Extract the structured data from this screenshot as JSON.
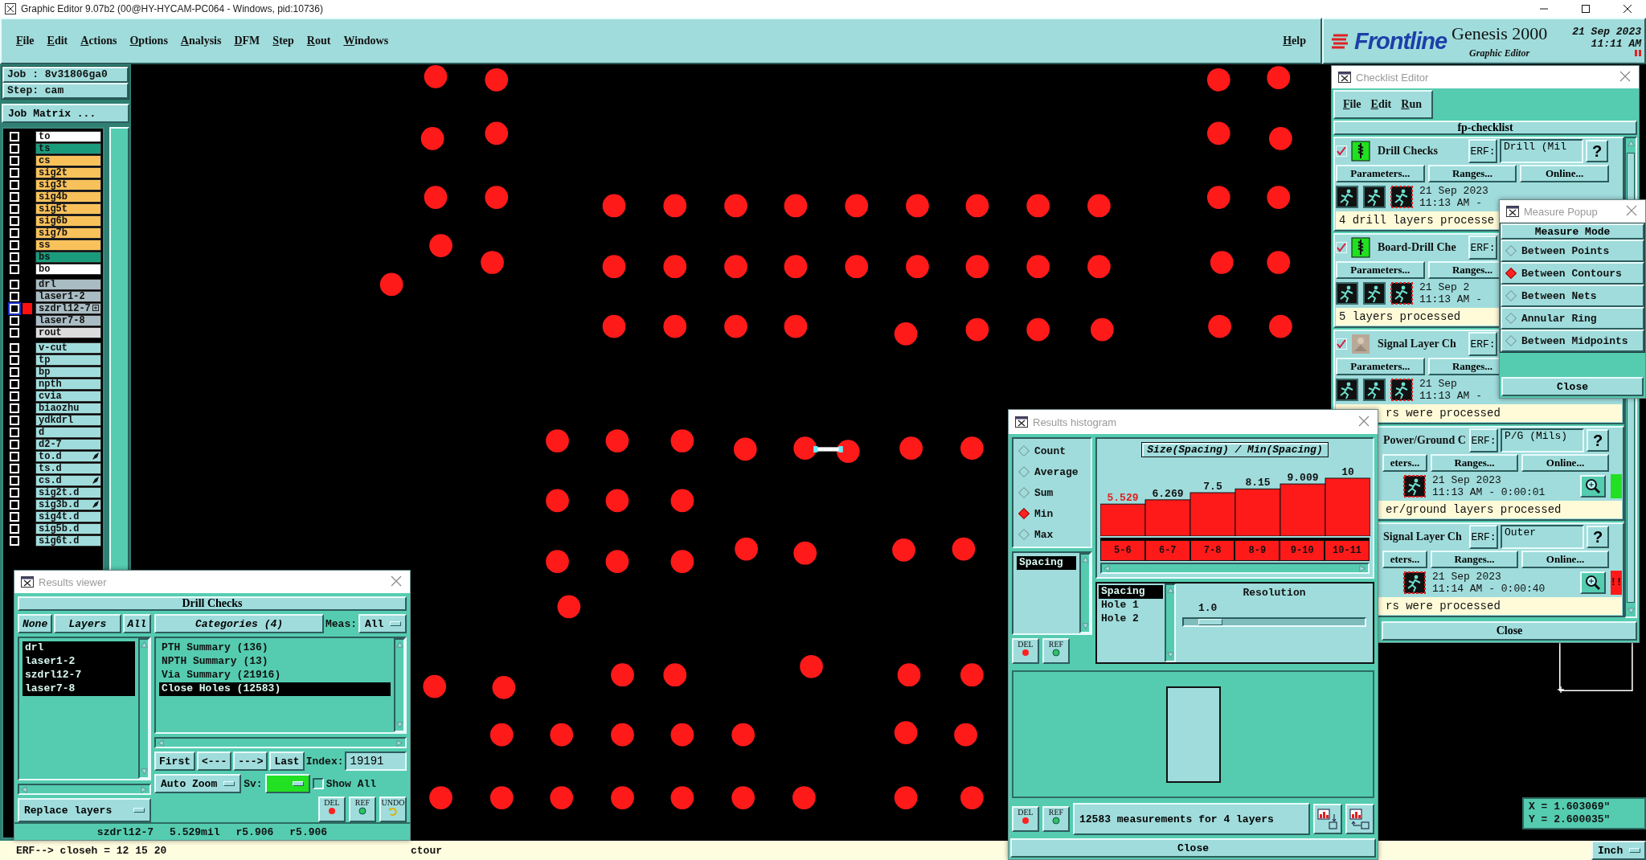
{
  "window": {
    "title": "Graphic Editor 9.07b2 (00@HY-HYCAM-PC064 - Windows, pid:10736)"
  },
  "menu": [
    "File",
    "Edit",
    "Actions",
    "Options",
    "Analysis",
    "DFM",
    "Step",
    "Rout",
    "Windows"
  ],
  "help_menu": "Help",
  "brand": {
    "logo": "Frontline",
    "product": "Genesis 2000",
    "module": "Graphic Editor",
    "date": "21 Sep 2023",
    "time": "11:11 AM"
  },
  "job": {
    "job": "Job : 8v31806ga0",
    "step": "Step: cam",
    "matrix_button": "Job Matrix ..."
  },
  "layer_groups": [
    [
      {
        "name": "to",
        "color": "#ffffff",
        "selected": false,
        "flagged": false
      },
      {
        "name": "ts",
        "color": "#1a9c7c",
        "selected": false,
        "flagged": false
      },
      {
        "name": "cs",
        "color": "#f8c15a",
        "selected": false,
        "flagged": false
      },
      {
        "name": "sig2t",
        "color": "#f8c15a",
        "selected": false,
        "flagged": false
      },
      {
        "name": "sig3t",
        "color": "#f8c15a",
        "selected": false,
        "flagged": false
      },
      {
        "name": "sig4b",
        "color": "#f8c15a",
        "selected": false,
        "flagged": false
      },
      {
        "name": "sig5t",
        "color": "#f8c15a",
        "selected": false,
        "flagged": false
      },
      {
        "name": "sig6b",
        "color": "#f8c15a",
        "selected": false,
        "flagged": false
      },
      {
        "name": "sig7b",
        "color": "#f8c15a",
        "selected": false,
        "flagged": false
      },
      {
        "name": "ss",
        "color": "#f8c15a",
        "selected": false,
        "flagged": false
      },
      {
        "name": "bs",
        "color": "#1a9c7c",
        "selected": false,
        "flagged": false
      },
      {
        "name": "bo",
        "color": "#ffffff",
        "selected": false,
        "flagged": false
      }
    ],
    [
      {
        "name": "drl",
        "color": "#a9bcc4",
        "selected": false,
        "flagged": false
      },
      {
        "name": "laser1-2",
        "color": "#a9bcc4",
        "selected": false,
        "flagged": false
      },
      {
        "name": "szdrl12-7",
        "color": "#a9bcc4",
        "selected": true,
        "flagged": false
      },
      {
        "name": "laser7-8",
        "color": "#a9bcc4",
        "selected": false,
        "flagged": false
      },
      {
        "name": "rout",
        "color": "#dcdcdc",
        "selected": false,
        "flagged": false
      }
    ],
    [
      {
        "name": "v-cut",
        "color": "#a0dcdc",
        "selected": false,
        "flagged": false
      },
      {
        "name": "tp",
        "color": "#a0dcdc",
        "selected": false,
        "flagged": false
      },
      {
        "name": "bp",
        "color": "#a0dcdc",
        "selected": false,
        "flagged": false
      },
      {
        "name": "npth",
        "color": "#a0dcdc",
        "selected": false,
        "flagged": false
      },
      {
        "name": "cvia",
        "color": "#a0dcdc",
        "selected": false,
        "flagged": false
      },
      {
        "name": "biaozhu",
        "color": "#a0dcdc",
        "selected": false,
        "flagged": false
      },
      {
        "name": "ydkdrl",
        "color": "#a0dcdc",
        "selected": false,
        "flagged": false
      },
      {
        "name": "d",
        "color": "#a0dcdc",
        "selected": false,
        "flagged": false
      },
      {
        "name": "d2-7",
        "color": "#a0dcdc",
        "selected": false,
        "flagged": false
      },
      {
        "name": "to.d",
        "color": "#a0dcdc",
        "selected": false,
        "flagged": true
      },
      {
        "name": "ts.d",
        "color": "#a0dcdc",
        "selected": false,
        "flagged": false
      },
      {
        "name": "cs.d",
        "color": "#a0dcdc",
        "selected": false,
        "flagged": true
      },
      {
        "name": "sig2t.d",
        "color": "#a0dcdc",
        "selected": false,
        "flagged": false
      },
      {
        "name": "sig3b.d",
        "color": "#a0dcdc",
        "selected": false,
        "flagged": true
      },
      {
        "name": "sig4t.d",
        "color": "#a0dcdc",
        "selected": false,
        "flagged": false
      },
      {
        "name": "sig5b.d",
        "color": "#a0dcdc",
        "selected": false,
        "flagged": false
      },
      {
        "name": "sig6t.d",
        "color": "#a0dcdc",
        "selected": false,
        "flagged": false
      }
    ]
  ],
  "coordinates": {
    "x": "X = 1.603069\"",
    "y": "Y = 2.600035\""
  },
  "status_bar": {
    "message": "ERF--> closeh = 12 15 20",
    "message_2": "ctour",
    "units": "Inch"
  },
  "results_viewer": {
    "title": "Results viewer",
    "check": "Drill Checks",
    "none_button": "None",
    "layers_label": "Layers",
    "all_button": "All",
    "layers": [
      {
        "name": "drl",
        "selected": true
      },
      {
        "name": "laser1-2",
        "selected": true
      },
      {
        "name": "szdrl12-7",
        "selected": true
      },
      {
        "name": "laser7-8",
        "selected": true
      }
    ],
    "categories_label": "Categories (4)",
    "meas_label": "Meas:",
    "meas_value": "All",
    "categories": [
      {
        "name": "PTH Summary (136)",
        "selected": false
      },
      {
        "name": "NPTH Summary (13)",
        "selected": false
      },
      {
        "name": "Via Summary (21916)",
        "selected": false
      },
      {
        "name": "Close Holes (12583)",
        "selected": true
      }
    ],
    "nav": [
      "First",
      "<---",
      "--->",
      "Last"
    ],
    "index_label": "Index:",
    "index_value": "19191",
    "zoom_mode": "Auto Zoom",
    "sv_label": "Sv:",
    "show_all": {
      "label": "Show All",
      "checked": false
    },
    "replace": "Replace layers",
    "tools": [
      {
        "label": "DEL",
        "kind": "delete"
      },
      {
        "label": "REF",
        "kind": "refresh"
      },
      {
        "label": "UNDO",
        "kind": "undo"
      }
    ],
    "info": [
      "szdrl12-7",
      "5.529mil",
      "r5.906",
      "r5.906"
    ]
  },
  "checklist": {
    "title": "Checklist Editor",
    "menu": [
      "File",
      "Edit",
      "Run"
    ],
    "name": "fp-checklist",
    "items": [
      {
        "kind": "top",
        "checked": true,
        "title": "Drill Checks",
        "erf_label": "ERF:",
        "erf_value": "Drill (Mil",
        "help": "?",
        "buttons": [
          "Parameters...",
          "Ranges...",
          "Online..."
        ],
        "date": "21 Sep 2023",
        "time": "11:13 AM -",
        "status": {
          "text": "4 drill layers processe",
          "kind": "full"
        }
      },
      {
        "kind": "top",
        "checked": true,
        "title": "Board-Drill Che",
        "erf_label": "ERF:",
        "buttons": [
          "Parameters...",
          "Ranges..."
        ],
        "date": "21 Sep 2",
        "time": "11:13 AM -",
        "status": {
          "text": "5 layers processed",
          "kind": "full"
        }
      },
      {
        "kind": "top",
        "checked": true,
        "title": "Signal Layer Ch",
        "erf_label": "ERF:",
        "buttons": [
          "Parameters...",
          "Ranges..."
        ],
        "date": "21 Sep",
        "time": "11:13 AM -",
        "status": {
          "text": "rs were processed",
          "kind": "cut_left"
        }
      },
      {
        "kind": "cut_left",
        "title": "Power/Ground C",
        "erf_label": "ERF:",
        "erf_value": "P/G (Mils)",
        "help": "?",
        "buttons": [
          "eters...",
          "Ranges...",
          "Online..."
        ],
        "date": "21 Sep 2023",
        "time": "11:13 AM - 0:00:01",
        "result": {
          "kind": "ok"
        },
        "status": {
          "text": "er/ground layers processed",
          "kind": "cut_left"
        }
      },
      {
        "kind": "cut_left",
        "title": "Signal Layer Ch",
        "erf_label": "ERF:",
        "erf_value": "Outer",
        "help": "?",
        "buttons": [
          "eters...",
          "Ranges...",
          "Online..."
        ],
        "date": "21 Sep 2023",
        "time": "11:14 AM - 0:00:40",
        "result": {
          "kind": "fail",
          "text": "!!"
        },
        "status": {
          "text": "rs were processed",
          "kind": "cut_left"
        }
      }
    ],
    "close": "Close"
  },
  "measure_popup": {
    "title": "Measure Popup",
    "header": "Measure Mode",
    "modes": [
      {
        "label": "Between Points",
        "selected": false
      },
      {
        "label": "Between Contours",
        "selected": true
      },
      {
        "label": "Between Nets",
        "selected": false
      },
      {
        "label": "Annular Ring",
        "selected": false
      },
      {
        "label": "Between Midpoints",
        "selected": false
      }
    ],
    "close": "Close"
  },
  "histogram": {
    "title": "Results histogram",
    "modes": [
      {
        "label": "Count",
        "selected": false
      },
      {
        "label": "Average",
        "selected": false
      },
      {
        "label": "Sum",
        "selected": false
      },
      {
        "label": "Min",
        "selected": true
      },
      {
        "label": "Max",
        "selected": false
      }
    ],
    "measures": [
      {
        "label": "Spacing",
        "selected": true
      }
    ],
    "tools": [
      {
        "label": "DEL",
        "kind": "delete"
      },
      {
        "label": "REF",
        "kind": "refresh"
      }
    ],
    "chart_data": {
      "type": "bar",
      "title": "Size(Spacing) / Min(Spacing)",
      "categories": [
        "5-6",
        "6-7",
        "7-8",
        "8-9",
        "9-10",
        "10-11"
      ],
      "values": [
        5.529,
        6.269,
        7.5,
        8.15,
        9.009,
        10
      ],
      "data_labels": true
    },
    "fields": [
      {
        "label": "Spacing",
        "selected": true
      },
      {
        "label": "Hole 1",
        "selected": false
      },
      {
        "label": "Hole 2",
        "selected": false
      }
    ],
    "resolution": {
      "label": "Resolution",
      "value": "1.0",
      "level": 0.08
    },
    "bottom_tools": [
      {
        "label": "DEL",
        "kind": "delete"
      },
      {
        "label": "REF",
        "kind": "refresh"
      }
    ],
    "summary": "12583 measurements for 4 layers",
    "close": "Close"
  }
}
